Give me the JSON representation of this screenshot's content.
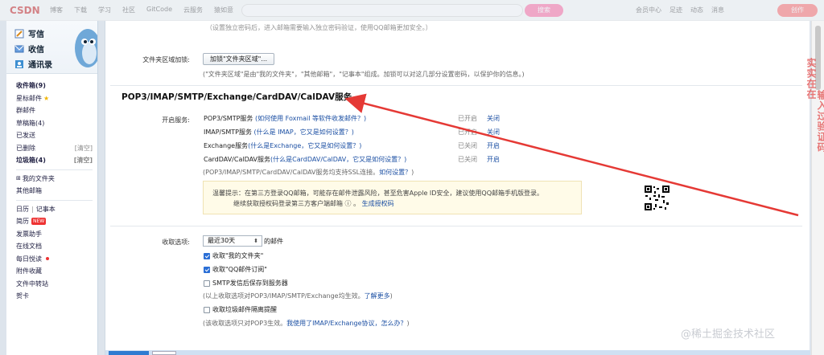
{
  "topbar": {
    "logo": "CSDN",
    "nav": [
      "博客",
      "下载",
      "学习",
      "社区",
      "GitCode",
      "云服务",
      "猿如意"
    ],
    "search_button": "搜索",
    "right": [
      "会员中心",
      "足迹",
      "动态",
      "消息"
    ],
    "create_button": "创作"
  },
  "sidebar": {
    "quick": [
      {
        "label": "写信",
        "icon": "pencil-icon"
      },
      {
        "label": "收信",
        "icon": "inbox-icon"
      },
      {
        "label": "通讯录",
        "icon": "contacts-icon"
      }
    ],
    "inbox": "收件箱(9)",
    "starred": "星标邮件",
    "group": "群邮件",
    "drafts": "草稿箱(4)",
    "sent": "已发送",
    "deleted": "已删除",
    "deleted_clear": "[清空]",
    "spam": "垃圾箱(4)",
    "spam_clear": "[清空]",
    "my_folders": "我的文件夹",
    "other_mail": "其他邮箱",
    "calendar": "日历",
    "notes": "记事本",
    "resume": "简历",
    "resume_badge": "NEW",
    "invoice": "发票助手",
    "docs": "在线文档",
    "daily": "每日悦读",
    "attachments": "附件收藏",
    "transfer": "文件中转站",
    "cards": "贺卡"
  },
  "main": {
    "top_note": "（设置独立密码后，进入邮箱需要输入独立密码验证，使用QQ邮箱更加安全。）",
    "folder_label": "文件夹区域加锁:",
    "folder_button": "加锁\"文件夹区域\"...",
    "folder_note": "(\"文件夹区域\"是由\"我的文件夹\"，\"其他邮箱\"，\"记事本\"组成。加锁可以对这几部分设置密码，以保护你的信息。)",
    "section_title": "POP3/IMAP/SMTP/Exchange/CardDAV/CalDAV服务",
    "enable_label": "开启服务:",
    "services": [
      {
        "name": "POP3/SMTP服务",
        "link": "(如何使用 Foxmail 等软件收发邮件？)",
        "status": "已开启",
        "action": "关闭"
      },
      {
        "name": "IMAP/SMTP服务",
        "link": "(什么是 IMAP，它又是如何设置？)",
        "status": "已开启",
        "action": "关闭"
      },
      {
        "name": "Exchange服务",
        "link": "(什么是Exchange，它又是如何设置？)",
        "status": "已关闭",
        "action": "开启"
      },
      {
        "name": "CardDAV/CalDAV服务",
        "link": "(什么是CardDAV/CalDAV，它又是如何设置？)",
        "status": "已关闭",
        "action": "开启"
      }
    ],
    "ssl_note": "(POP3/IMAP/SMTP/CardDAV/CalDAV服务均支持SSL连接。",
    "ssl_link": "如何设置？",
    "ssl_close": ")",
    "tip_line1": "温馨提示：在第三方登录QQ邮箱，可能存在邮件泄露风险，甚至危害Apple ID安全，建议使用QQ邮箱手机版登录。",
    "tip_line2_prefix": "继续获取授权码登录第三方客户端邮箱 ⓘ 。",
    "tip_line2_link": "生成授权码",
    "receive_label": "收取选项:",
    "select_value": "最近30天",
    "select_suffix": "的邮件",
    "checkboxes": [
      {
        "label": "收取\"我的文件夹\"",
        "checked": true
      },
      {
        "label": "收取\"QQ邮件订阅\"",
        "checked": true
      },
      {
        "label": "SMTP发信后保存到服务器",
        "checked": false
      }
    ],
    "effect_note_prefix": "(以上收取选项对POP3/IMAP/SMTP/Exchange均生效。",
    "effect_note_link": "了解更多",
    "effect_note_close": ")",
    "spam_checkbox": {
      "label": "收取垃圾邮件隔离提醒",
      "checked": false
    },
    "spam_note_prefix": "(该收取选项只对POP3生效。",
    "spam_note_link": "我使用了IMAP/Exchange协议，怎么办？",
    "spam_note_close": ")"
  },
  "annotation": {
    "vertical_text_1": "实实在在",
    "vertical_text_2": "输入过验证码",
    "color": "#e34b4b"
  },
  "watermark": "@稀土掘金技术社区"
}
